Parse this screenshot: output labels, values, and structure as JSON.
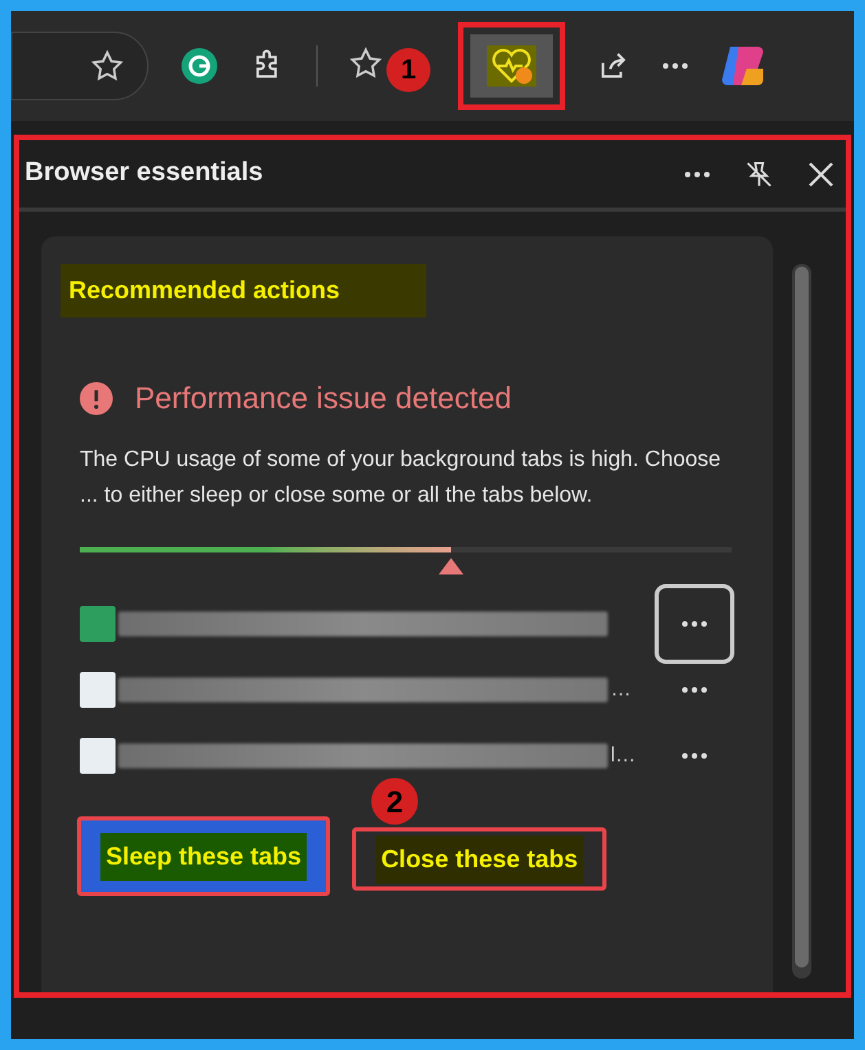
{
  "toolbar": {
    "annotation": "1",
    "warning": true
  },
  "panel": {
    "title": "Browser essentials"
  },
  "card": {
    "heading": "Recommended actions",
    "alert_title": "Performance issue detected",
    "message": "The CPU usage of some of your background tabs is high. Choose ... to either sleep or close some or all the tabs below.",
    "usage": {
      "level": 0.57
    },
    "tabs": [
      {
        "color": "#2e9e5e",
        "focused": true
      },
      {
        "color": "#e8eef2",
        "title_end": "…",
        "focused": false
      },
      {
        "color": "#e8eef2",
        "title_end": "l…",
        "focused": false
      }
    ],
    "annotation": "2",
    "buttons": [
      {
        "label": "Sleep these tabs",
        "kind": "primary"
      },
      {
        "label": "Close these tabs",
        "kind": "secondary"
      }
    ]
  }
}
